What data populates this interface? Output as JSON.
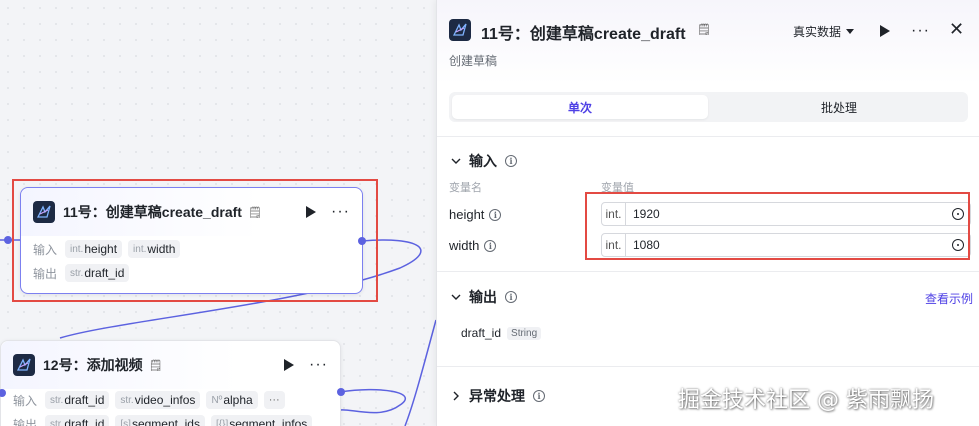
{
  "node1": {
    "title": "11号：创建草稿create_draft",
    "input_label": "输入",
    "output_label": "输出",
    "inputs": [
      {
        "type": "int.",
        "name": "height"
      },
      {
        "type": "int.",
        "name": "width"
      }
    ],
    "outputs": [
      {
        "type": "str.",
        "name": "draft_id"
      }
    ]
  },
  "node2": {
    "title": "12号：添加视频",
    "input_label": "输入",
    "output_label": "输出",
    "inputs": [
      {
        "type": "str.",
        "name": "draft_id"
      },
      {
        "type": "str.",
        "name": "video_infos"
      },
      {
        "type": "Nº",
        "name": "alpha"
      }
    ],
    "inputs_more": "···",
    "outputs": [
      {
        "type": "str.",
        "name": "draft_id"
      },
      {
        "type": "[s]",
        "name": "segment_ids"
      },
      {
        "type": "[{}]",
        "name": "segment_infos"
      }
    ]
  },
  "panel": {
    "title": "11号：创建草稿create_draft",
    "description": "创建草稿",
    "data_select": "真实数据",
    "tabs": [
      {
        "label": "单次",
        "active": true
      },
      {
        "label": "批处理",
        "active": false
      }
    ],
    "input_section": {
      "title": "输入",
      "col_name": "变量名",
      "col_value": "变量值",
      "params": [
        {
          "name": "height",
          "type": "int.",
          "value": "1920"
        },
        {
          "name": "width",
          "type": "int.",
          "value": "1080"
        }
      ]
    },
    "output_section": {
      "title": "输出",
      "view_example": "查看示例",
      "outputs": [
        {
          "name": "draft_id",
          "type": "String"
        }
      ]
    },
    "error_section": {
      "title": "异常处理"
    }
  },
  "watermark": "掘金技术社区 @ 紫雨飘扬",
  "colors": {
    "accent": "#4e40e5",
    "port": "#5c62e0",
    "highlight": "#e34a43"
  }
}
